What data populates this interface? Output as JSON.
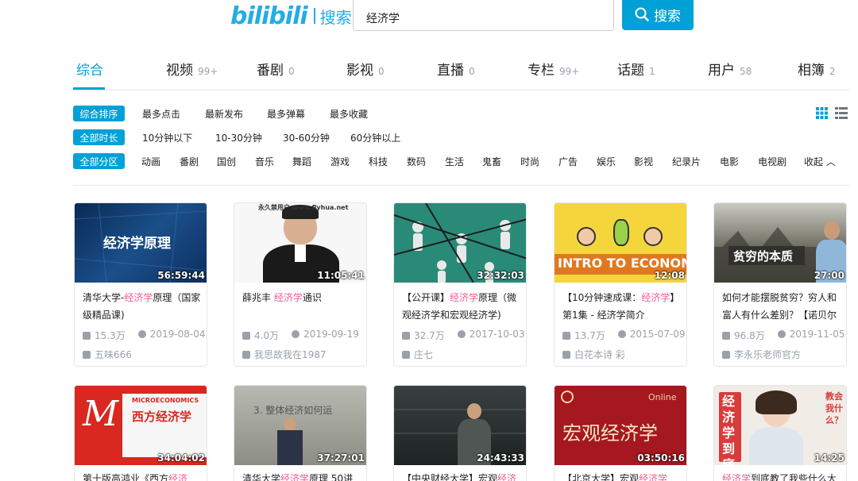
{
  "header": {
    "logo": "bilibili",
    "logo_label": "搜索",
    "search_value": "经济学",
    "search_button": "搜索"
  },
  "tabs": [
    {
      "label": "综合",
      "count": ""
    },
    {
      "label": "视频",
      "count": "99+"
    },
    {
      "label": "番剧",
      "count": "0"
    },
    {
      "label": "影视",
      "count": "0"
    },
    {
      "label": "直播",
      "count": "0"
    },
    {
      "label": "专栏",
      "count": "99+"
    },
    {
      "label": "话题",
      "count": "1"
    },
    {
      "label": "用户",
      "count": "58"
    },
    {
      "label": "相簿",
      "count": "2"
    }
  ],
  "filters": {
    "sort": {
      "tag": "综合排序",
      "items": [
        "最多点击",
        "最新发布",
        "最多弹幕",
        "最多收藏"
      ]
    },
    "duration": {
      "tag": "全部时长",
      "items": [
        "10分钟以下",
        "10-30分钟",
        "30-60分钟",
        "60分钟以上"
      ]
    },
    "zone": {
      "tag": "全部分区",
      "items": [
        "动画",
        "番剧",
        "国创",
        "音乐",
        "舞蹈",
        "游戏",
        "科技",
        "数码",
        "生活",
        "鬼畜",
        "时尚",
        "广告",
        "娱乐",
        "影视",
        "纪录片",
        "电影",
        "电视剧"
      ],
      "collapse": "收起"
    }
  },
  "colors": {
    "accent": "#00a1d6",
    "highlight": "#f25d8e",
    "meta": "#99a2aa"
  },
  "videos": [
    {
      "thumb_text": "经济学原理",
      "duration": "56:59:44",
      "title_pre": "清华大学-",
      "title_hl": "经济学",
      "title_post": "原理（国家级精品课)",
      "views": "15.3万",
      "date": "2019-08-04",
      "uploader": "五味666"
    },
    {
      "thumb_text": "永久禁用户 www.flyhua.net",
      "duration": "11:05:41",
      "title_pre": "薛兆丰 ",
      "title_hl": "经济学",
      "title_post": "通识",
      "views": "4.0万",
      "date": "2019-09-19",
      "uploader": "我思故我在1987"
    },
    {
      "thumb_text": "",
      "duration": "32:32:03",
      "title_pre": "【公开课】",
      "title_hl": "经济学",
      "title_post": "原理（微观经济学和宏观经济学)",
      "views": "32.7万",
      "date": "2017-10-03",
      "uploader": "庄七"
    },
    {
      "thumb_text": "INTRO TO ECONOMICS",
      "duration": "12:08",
      "title_pre": "【10分钟速成课：",
      "title_hl": "经济学",
      "title_post": "】第1集 - 经济学简介",
      "views": "13.7万",
      "date": "2015-07-09",
      "uploader": "白花本诗 彩"
    },
    {
      "thumb_text": "贫穷的本质",
      "duration": "27:00",
      "title_pre": "如何才能摆脱贫穷？穷人和富人有什么差别？【诺贝尔",
      "title_hl": "",
      "title_post": "",
      "views": "96.8万",
      "date": "2019-11-05",
      "uploader": "李永乐老师官方"
    },
    {
      "thumb_text": "西方经济学",
      "thumb_sub": "MICROECONOMICS",
      "duration": "34:04:02",
      "title_pre": "第十版高鸿业《西方",
      "title_hl": "经济",
      "title_post": "",
      "views": "",
      "date": "",
      "uploader": ""
    },
    {
      "thumb_text": "3. 整体经济如何运",
      "duration": "37:27:01",
      "title_pre": "清华大学",
      "title_hl": "经济学",
      "title_post": "原理 50讲",
      "views": "",
      "date": "",
      "uploader": ""
    },
    {
      "thumb_text": "",
      "duration": "24:43:33",
      "title_pre": "【中央财经大学】宏观",
      "title_hl": "经济",
      "title_post": "",
      "views": "",
      "date": "",
      "uploader": ""
    },
    {
      "thumb_text": "宏观经济学",
      "thumb_sub": "Online",
      "duration": "03:50:16",
      "title_pre": "【北京大学】宏观",
      "title_hl": "经济学",
      "title_post": "",
      "views": "",
      "date": "",
      "uploader": ""
    },
    {
      "thumb_text": "经济学到底",
      "thumb_sub": "教会我什么？",
      "duration": "14:25",
      "title_pre": "",
      "title_hl": "经济学",
      "title_post": "到底教了我些什么大道",
      "views": "",
      "date": "",
      "uploader": ""
    }
  ]
}
